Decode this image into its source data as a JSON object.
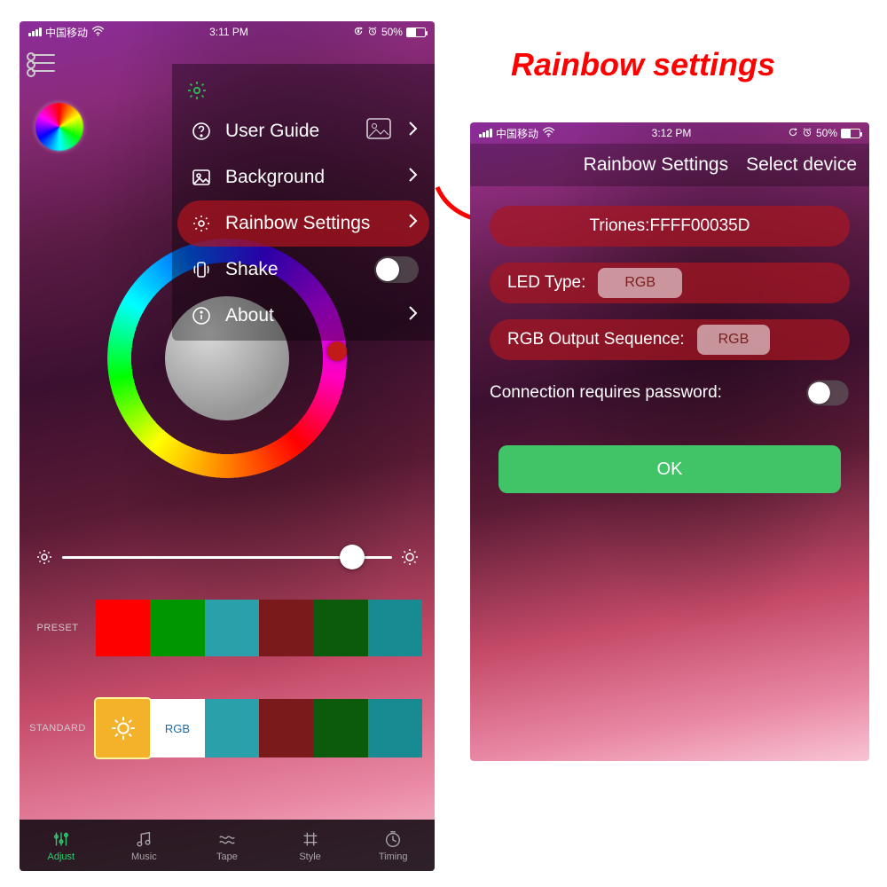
{
  "annotation": {
    "title_text": "Rainbow settings"
  },
  "left": {
    "status": {
      "carrier": "中国移动",
      "time": "3:11 PM",
      "battery_pct": "50%"
    },
    "menu": {
      "items": [
        {
          "icon": "question",
          "label": "User Guide"
        },
        {
          "icon": "image",
          "label": "Background"
        },
        {
          "icon": "gear",
          "label": "Rainbow Settings"
        },
        {
          "icon": "shake",
          "label": "Shake"
        },
        {
          "icon": "info",
          "label": "About"
        }
      ]
    },
    "preset_label": "PRESET",
    "standard_label": "STANDARD",
    "standard_rgb_label": "RGB",
    "preset_colors": [
      "#ff0000",
      "#009600",
      "#2aa0aa",
      "#7a1a1a",
      "#0c5a0c",
      "#188a92"
    ],
    "standard_colors": [
      "#f4b22a",
      "#ffffff",
      "#2aa0aa",
      "#7a1a1a",
      "#0c5a0c",
      "#188a92"
    ],
    "tabs": [
      "Adjust",
      "Music",
      "Tape",
      "Style",
      "Timing"
    ],
    "brightness_pct": 88
  },
  "right": {
    "status": {
      "carrier": "中国移动",
      "time": "3:12 PM",
      "battery_pct": "50%"
    },
    "header": {
      "title": "Rainbow Settings",
      "action": "Select device"
    },
    "device": "Triones:FFFF00035D",
    "led_type_label": "LED Type:",
    "led_type_value": "RGB",
    "seq_label": "RGB Output Sequence:",
    "seq_value": "RGB",
    "password_label": "Connection requires password:",
    "ok": "OK"
  }
}
